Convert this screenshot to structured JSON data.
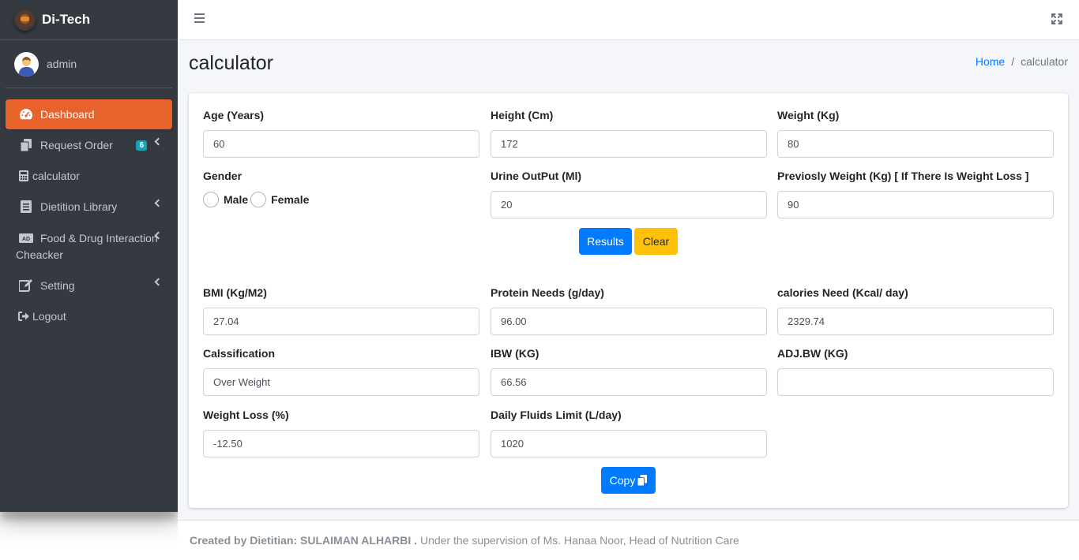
{
  "brand": {
    "name": "Di-Tech"
  },
  "user": {
    "name": "admin"
  },
  "sidebar": {
    "items": [
      {
        "label": "Dashboard",
        "icon": "tachometer-icon"
      },
      {
        "label": "Request Order",
        "icon": "copy-icon",
        "badge": "6"
      },
      {
        "label": "calculator",
        "icon": "calculator-icon"
      },
      {
        "label": "Dietition Library",
        "icon": "book-icon"
      },
      {
        "label": "Food & Drug Interaction Cheacker",
        "icon": "ad-icon"
      },
      {
        "label": "Setting",
        "icon": "edit-icon"
      },
      {
        "label": "Logout",
        "icon": "sign-out-icon"
      }
    ]
  },
  "page": {
    "title": "calculator"
  },
  "breadcrumb": {
    "home": "Home",
    "separator": "/",
    "current": "calculator"
  },
  "form": {
    "age": {
      "label": "Age (Years)",
      "value": "60"
    },
    "height": {
      "label": "Height (Cm)",
      "value": "172"
    },
    "weight": {
      "label": "Weight (Kg)",
      "value": "80"
    },
    "gender": {
      "label": "Gender",
      "male": "Male",
      "female": "Female"
    },
    "urine": {
      "label": "Urine OutPut (Ml)",
      "value": "20"
    },
    "prev_weight": {
      "label": "Previosly Weight (Kg) [ If There Is Weight Loss ]",
      "value": "90"
    },
    "results_button": "Results",
    "clear_button": "Clear"
  },
  "results": {
    "bmi": {
      "label": "BMI (Kg/M2)",
      "value": "27.04"
    },
    "protein": {
      "label": "Protein Needs (g/day)",
      "value": "96.00"
    },
    "calories": {
      "label": "calories Need (Kcal/ day)",
      "value": "2329.74"
    },
    "classification": {
      "label": "Calssification",
      "value": "Over Weight"
    },
    "ibw": {
      "label": "IBW (KG)",
      "value": "66.56"
    },
    "adjbw": {
      "label": "ADJ.BW (KG)",
      "value": ""
    },
    "weight_loss": {
      "label": "Weight Loss (%)",
      "value": "-12.50"
    },
    "fluids": {
      "label": "Daily Fluids Limit (L/day)",
      "value": "1020"
    },
    "copy_button": "Copy"
  },
  "footer": {
    "created_by": "Created by Dietitian: SULAIMAN ALHARBI .",
    "supervision": "Under the supervision of Ms. Hanaa Noor, Head of Nutrition Care"
  },
  "colors": {
    "sidebar_bg": "#343a40",
    "active_item": "#e8632b",
    "primary": "#007bff",
    "warning": "#ffc107",
    "badge": "#17a2b8"
  }
}
